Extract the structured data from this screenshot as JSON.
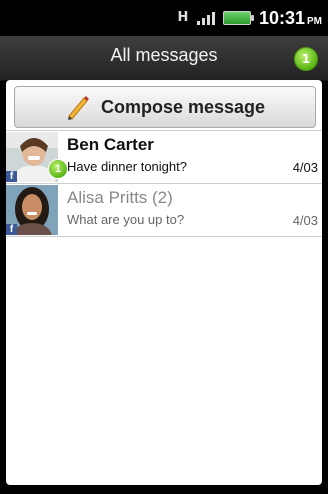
{
  "status_bar": {
    "network_type": "H",
    "time": "10:31",
    "ampm": "PM"
  },
  "header": {
    "title": "All messages",
    "unread_count": "1",
    "badge_color": "#6cc21d"
  },
  "compose": {
    "label": "Compose message"
  },
  "threads": [
    {
      "name": "Ben Carter",
      "snippet": "Have dinner tonight?",
      "date": "4/03",
      "unread_badge": "1",
      "unread": true,
      "avatar_icon": "facebook-icon"
    },
    {
      "name": "Alisa Pritts (2)",
      "snippet": "What are you up to?",
      "date": "4/03",
      "unread": false,
      "avatar_icon": "facebook-icon"
    }
  ],
  "colors": {
    "facebook": "#3b5998",
    "accent": "#6cc21d"
  }
}
